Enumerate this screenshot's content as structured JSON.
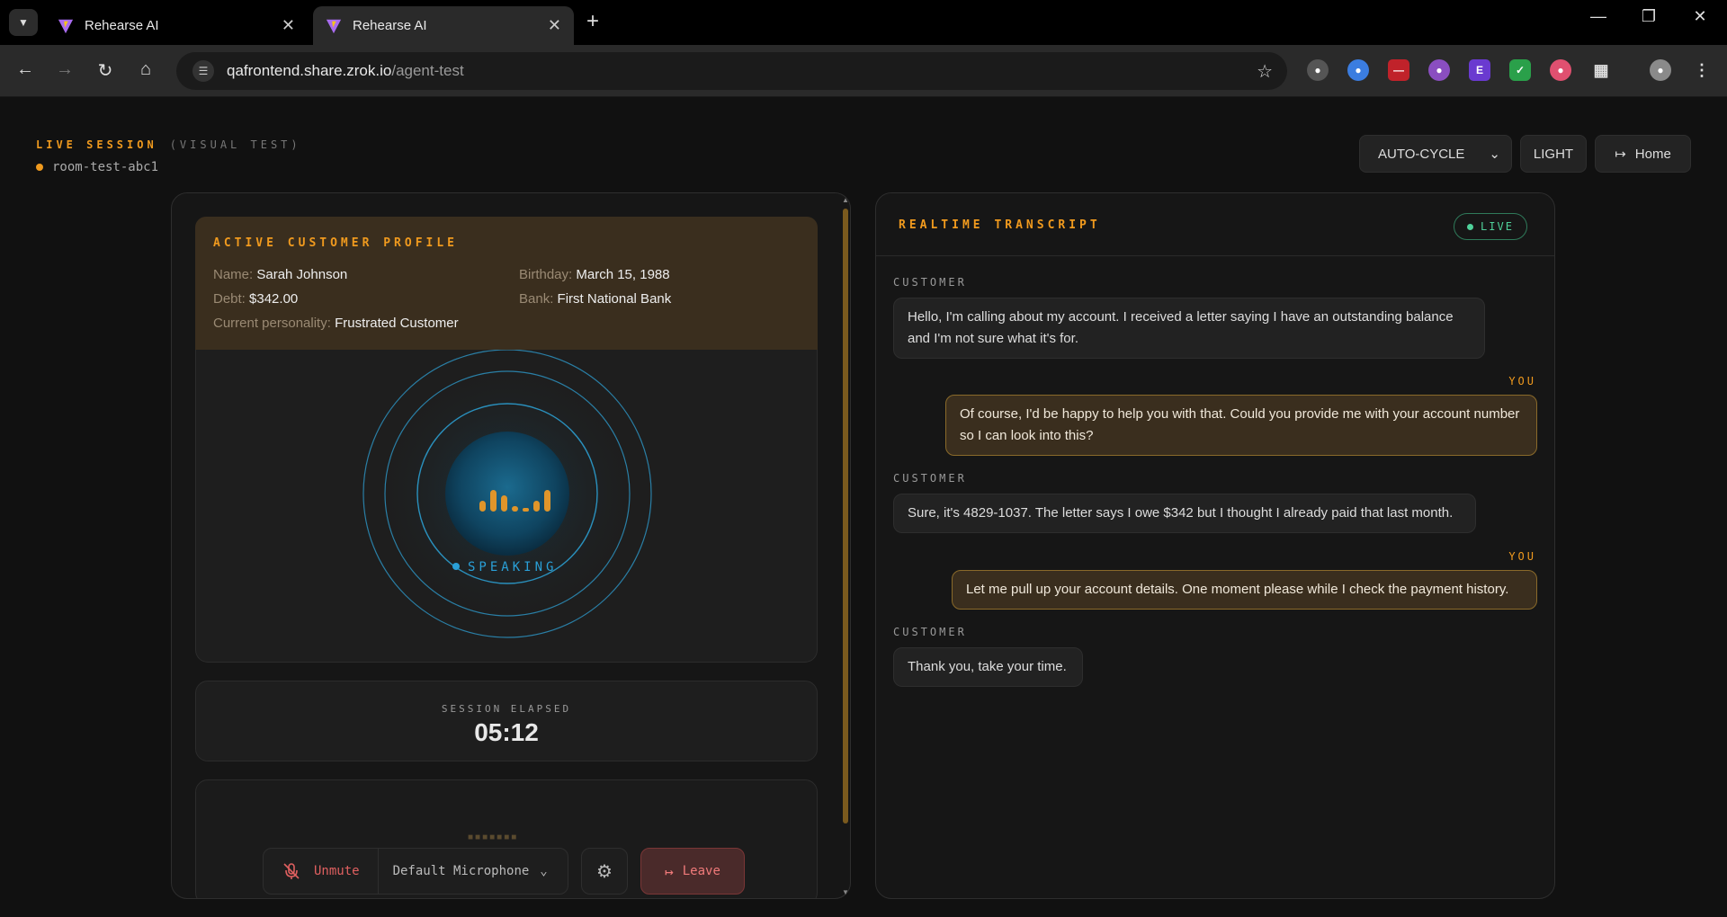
{
  "browser": {
    "tabs": [
      {
        "title": "Rehearse AI"
      },
      {
        "title": "Rehearse AI"
      }
    ],
    "url_host": "qafrontend.share.zrok.io",
    "url_path": "/agent-test"
  },
  "header": {
    "title": "LIVE SESSION",
    "subtitle": "(VISUAL TEST)",
    "room": "room-test-abc1",
    "mode_select": "AUTO-CYCLE",
    "theme_button": "LIGHT",
    "home_button": "Home"
  },
  "profile": {
    "heading": "ACTIVE CUSTOMER PROFILE",
    "fields": [
      {
        "label": "Name:",
        "value": "Sarah Johnson"
      },
      {
        "label": "Birthday:",
        "value": "March 15, 1988"
      },
      {
        "label": "Debt:",
        "value": "$342.00"
      },
      {
        "label": "Bank:",
        "value": "First National Bank"
      },
      {
        "label": "Current personality:",
        "value": "Frustrated Customer"
      }
    ]
  },
  "visualizer": {
    "status": "SPEAKING"
  },
  "session": {
    "label": "SESSION ELAPSED",
    "elapsed": "05:12"
  },
  "controls": {
    "unmute": "Unmute",
    "microphone": "Default Microphone",
    "leave": "Leave"
  },
  "transcript": {
    "heading": "REALTIME TRANSCRIPT",
    "badge": "LIVE",
    "messages": [
      {
        "speaker": "CUSTOMER",
        "text": "Hello, I'm calling about my account. I received a letter saying I have an outstanding balance and I'm not sure what it's for."
      },
      {
        "speaker": "YOU",
        "text": "Of course, I'd be happy to help you with that. Could you provide me with your account number so I can look into this?"
      },
      {
        "speaker": "CUSTOMER",
        "text": "Sure, it's 4829-1037. The letter says I owe $342 but I thought I already paid that last month."
      },
      {
        "speaker": "YOU",
        "text": "Let me pull up your account details. One moment please while I check the payment history."
      },
      {
        "speaker": "CUSTOMER",
        "text": "Thank you, take your time."
      }
    ]
  },
  "colors": {
    "accent": "#f09a1e",
    "live": "#4fd19a",
    "danger": "#e06060",
    "speaking": "#2aa0d8"
  }
}
